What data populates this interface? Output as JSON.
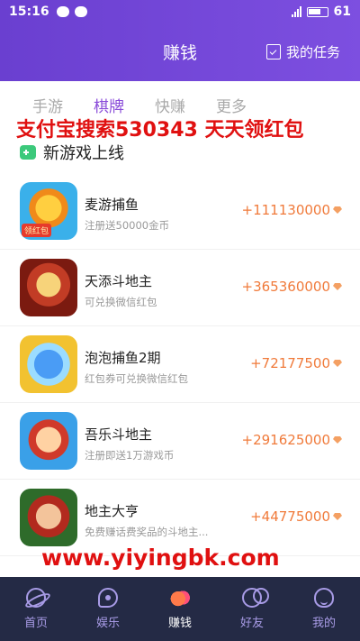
{
  "status_bar": {
    "time": "15:16",
    "battery": "61"
  },
  "header": {
    "title": "赚钱",
    "task_label": "我的任务"
  },
  "tabs": [
    {
      "label": "手游",
      "active": false
    },
    {
      "label": "棋牌",
      "active": true
    },
    {
      "label": "快赚",
      "active": false
    },
    {
      "label": "更多",
      "active": false
    }
  ],
  "promo_text": "支付宝搜索530343 天天领红包",
  "section_title": "新游戏上线",
  "games": [
    {
      "name": "麦游捕鱼",
      "desc": "注册送50000金币",
      "reward": "+111130000",
      "badge": "领红包"
    },
    {
      "name": "天添斗地主",
      "desc": "可兑换微信红包",
      "reward": "+365360000",
      "badge": ""
    },
    {
      "name": "泡泡捕鱼2期",
      "desc": "红包券可兑换微信红包",
      "reward": "+72177500",
      "badge": ""
    },
    {
      "name": "吾乐斗地主",
      "desc": "注册即送1万游戏币",
      "reward": "+291625000",
      "badge": ""
    },
    {
      "name": "地主大亨",
      "desc": "免费赚话费奖品的斗地主...",
      "reward": "+44775000",
      "badge": ""
    }
  ],
  "watermark": "www.yiyingbk.com",
  "bottom_nav": [
    {
      "label": "首页",
      "icon": "home-planet-icon"
    },
    {
      "label": "娱乐",
      "icon": "chat-bubble-icon"
    },
    {
      "label": "赚钱",
      "icon": "earn-icon",
      "active": true
    },
    {
      "label": "好友",
      "icon": "friends-icon"
    },
    {
      "label": "我的",
      "icon": "profile-icon"
    }
  ],
  "colors": {
    "primary": "#7d4fe0",
    "reward": "#f07a3a",
    "promo": "#e01010",
    "nav_bg": "#242a45"
  }
}
